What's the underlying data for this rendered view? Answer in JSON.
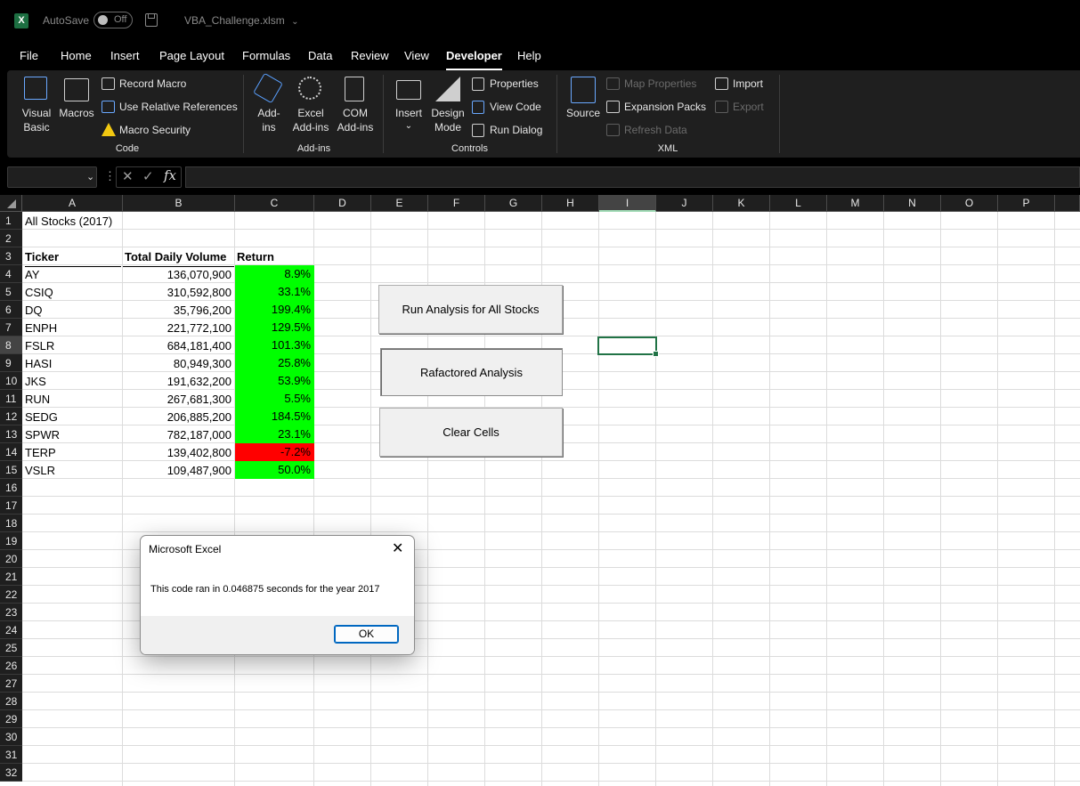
{
  "titlebar": {
    "logo": "X",
    "autosave_label": "AutoSave",
    "autosave_state": "Off",
    "file_name": "VBA_Challenge.xlsm",
    "file_chevron": "⌄"
  },
  "menu": [
    "File",
    "Home",
    "Insert",
    "Page Layout",
    "Formulas",
    "Data",
    "Review",
    "View",
    "Developer",
    "Help"
  ],
  "active_tab": "Developer",
  "ribbon": {
    "code": {
      "label": "Code",
      "visual_basic": [
        "Visual",
        "Basic"
      ],
      "macros": "Macros",
      "record_macro": "Record Macro",
      "use_relative": "Use Relative References",
      "macro_security": "Macro Security"
    },
    "addins": {
      "label": "Add-ins",
      "addins": [
        "Add-",
        "ins"
      ],
      "excel_addins": [
        "Excel",
        "Add-ins"
      ],
      "com_addins": [
        "COM",
        "Add-ins"
      ]
    },
    "controls": {
      "label": "Controls",
      "insert": "Insert",
      "insert_chev": "⌄",
      "design_mode": [
        "Design",
        "Mode"
      ],
      "properties": "Properties",
      "view_code": "View Code",
      "run_dialog": "Run Dialog"
    },
    "xml": {
      "label": "XML",
      "source": "Source",
      "map_properties": "Map Properties",
      "expansion_packs": "Expansion Packs",
      "refresh_data": "Refresh Data",
      "import": "Import",
      "export": "Export"
    }
  },
  "formula_bar": {
    "name_box": "",
    "chevron": "⌄",
    "dots": "⋮",
    "cancel": "✕",
    "enter": "✓",
    "fx": "fx",
    "formula": ""
  },
  "sheet": {
    "columns": [
      "A",
      "B",
      "C",
      "D",
      "E",
      "F",
      "G",
      "H",
      "I",
      "J",
      "K",
      "L",
      "M",
      "N",
      "O",
      "P",
      ""
    ],
    "selected_column": "I",
    "selected_row": "8",
    "rows": [
      "1",
      "2",
      "3",
      "4",
      "5",
      "6",
      "7",
      "8",
      "9",
      "10",
      "11",
      "12",
      "13",
      "14",
      "15",
      "16",
      "17",
      "18",
      "19",
      "20",
      "21",
      "22",
      "23",
      "24",
      "25",
      "26",
      "27",
      "28",
      "29",
      "30",
      "31",
      "32"
    ],
    "title": "All Stocks (2017)",
    "headers": {
      "ticker": "Ticker",
      "volume": "Total Daily Volume",
      "return": "Return"
    },
    "data": [
      {
        "ticker": "AY",
        "volume": "136,070,900",
        "return": "8.9%",
        "positive": true
      },
      {
        "ticker": "CSIQ",
        "volume": "310,592,800",
        "return": "33.1%",
        "positive": true
      },
      {
        "ticker": "DQ",
        "volume": "35,796,200",
        "return": "199.4%",
        "positive": true
      },
      {
        "ticker": "ENPH",
        "volume": "221,772,100",
        "return": "129.5%",
        "positive": true
      },
      {
        "ticker": "FSLR",
        "volume": "684,181,400",
        "return": "101.3%",
        "positive": true
      },
      {
        "ticker": "HASI",
        "volume": "80,949,300",
        "return": "25.8%",
        "positive": true
      },
      {
        "ticker": "JKS",
        "volume": "191,632,200",
        "return": "53.9%",
        "positive": true
      },
      {
        "ticker": "RUN",
        "volume": "267,681,300",
        "return": "5.5%",
        "positive": true
      },
      {
        "ticker": "SEDG",
        "volume": "206,885,200",
        "return": "184.5%",
        "positive": true
      },
      {
        "ticker": "SPWR",
        "volume": "782,187,000",
        "return": "23.1%",
        "positive": true
      },
      {
        "ticker": "TERP",
        "volume": "139,402,800",
        "return": "-7.2%",
        "positive": false
      },
      {
        "ticker": "VSLR",
        "volume": "109,487,900",
        "return": "50.0%",
        "positive": true
      }
    ],
    "colors": {
      "positive": "#00ff00",
      "negative": "#ff0000"
    }
  },
  "buttons": {
    "run_all": "Run Analysis for All Stocks",
    "refactored": "Rafactored Analysis",
    "clear": "Clear Cells"
  },
  "dialog": {
    "title": "Microsoft Excel",
    "close": "✕",
    "message": "This code ran in 0.046875 seconds for the year 2017",
    "ok": "OK"
  }
}
